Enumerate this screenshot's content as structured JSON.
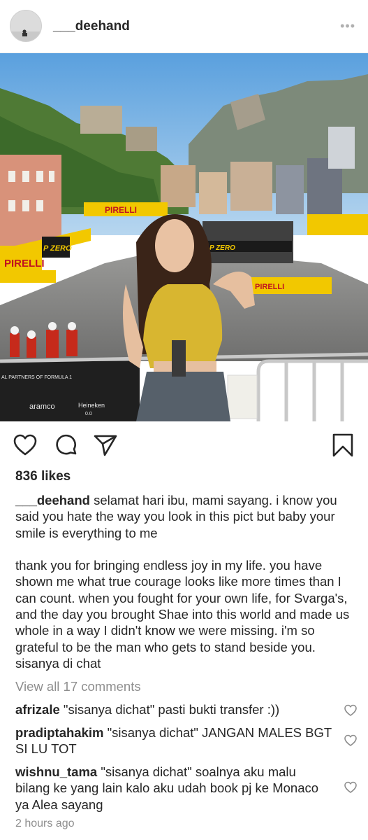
{
  "post": {
    "username": "___deehand",
    "more_label": "•••",
    "likes": "836 likes",
    "caption": {
      "username": "___deehand",
      "paragraph1": "selamat hari ibu, mami sayang. i know you said you hate the way you look in this pict but baby your smile is everything to me",
      "paragraph2": "thank you for bringing endless joy in my life. you have shown me what true courage looks like more times than I can count. when you fought for your own life, for Svarga's, and the day you brought Shae into this world and made us whole in a way I didn't know we were missing. i'm so grateful to be the man who gets to stand beside you. sisanya di chat"
    },
    "view_all_comments": "View all 17 comments",
    "comments": [
      {
        "username": "afrizale",
        "text": "\"sisanya dichat\" pasti bukti transfer :))"
      },
      {
        "username": "pradiptahakim",
        "text": "\"sisanya dichat\" JANGAN MALES BGT SI LU TOT"
      },
      {
        "username": "wishnu_tama",
        "text": "\"sisanya dichat\" soalnya aku malu bilang ke yang lain kalo aku udah book pj ke Monaco ya Alea sayang"
      }
    ],
    "timestamp": "2 hours ago"
  },
  "photo_signage": {
    "pirelli_top": "PIRELLI",
    "pzero_left": "P ZERO",
    "pirelli_left": "PIRELLI",
    "pzero_right": "P ZERO",
    "pirelli_right": "PIRELLI",
    "partners": "AL PARTNERS OF FORMULA 1",
    "aramco": "aramco",
    "heineken": "Heineken",
    "heineken_sub": "0.0"
  },
  "icons": [
    "heart-icon",
    "comment-icon",
    "share-icon",
    "bookmark-icon",
    "more-icon"
  ],
  "colors": {
    "text": "#262626",
    "muted": "#8e8e8e",
    "divider": "#efefef",
    "pirelli_yellow": "#f2c800"
  }
}
